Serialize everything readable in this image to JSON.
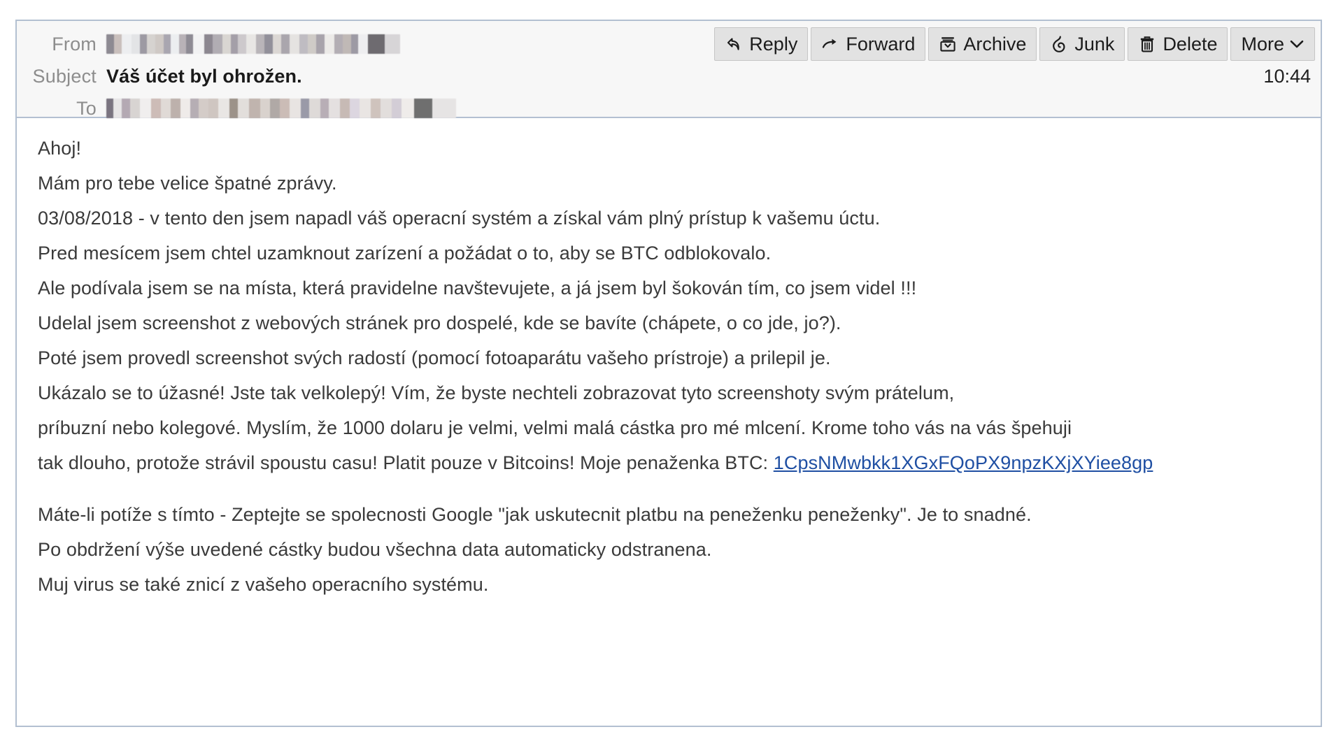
{
  "header": {
    "from_label": "From",
    "subject_label": "Subject",
    "to_label": "To",
    "from_value_redacted": true,
    "to_value_redacted": true,
    "subject": "Váš účet byl ohrožen.",
    "timestamp": "10:44"
  },
  "toolbar": {
    "buttons": [
      {
        "label": "Reply",
        "icon": "reply-arrow-icon"
      },
      {
        "label": "Forward",
        "icon": "forward-arrow-icon"
      },
      {
        "label": "Archive",
        "icon": "archive-box-icon"
      },
      {
        "label": "Junk",
        "icon": "flame-icon"
      },
      {
        "label": "Delete",
        "icon": "trash-icon"
      },
      {
        "label": "More",
        "icon": "chevron-down-icon"
      }
    ]
  },
  "body": {
    "lines": [
      "Ahoj!",
      "Mám pro tebe velice špatné zprávy.",
      "03/08/2018 - v tento den jsem napadl váš operacní systém a získal vám plný prístup k vašemu úctu.",
      "Pred mesícem jsem chtel uzamknout zarízení a požádat o to, aby se BTC odblokovalo.",
      "Ale podívala jsem se na místa, která pravidelne navštevujete, a já jsem byl šokován tím, co jsem videl !!!",
      "Udelal jsem screenshot z webových stránek pro dospelé, kde se bavíte (chápete, o co jde, jo?).",
      "Poté jsem provedl screenshot svých radostí (pomocí fotoaparátu vašeho prístroje) a prilepil je.",
      "Ukázalo se to úžasné! Jste tak velkolepý! Vím, že byste nechteli zobrazovat tyto screenshoty svým prátelum,",
      "príbuzní nebo kolegové. Myslím, že 1000 dolaru je velmi, velmi malá cástka pro mé mlcení. Krome toho vás na vás špehuji"
    ],
    "btc_line_prefix": "tak dlouho, protože strávil spoustu casu! Platit pouze v Bitcoins! Moje penaženka BTC: ",
    "btc_address": "1CpsNMwbkk1XGxFQoPX9npzKXjXYiee8gp",
    "closing_lines": [
      "Máte-li potíže s tímto - Zeptejte se spolecnosti Google \"jak uskutecnit platbu na peneženku peneženky\". Je to snadné.",
      "Po obdržení výše uvedené cástky budou všechna data automaticky odstranena.",
      "Muj virus se také znicí z vašeho operacního systému."
    ]
  },
  "colors": {
    "panel_border": "#b3c0d1",
    "header_bg": "#f7f7f7",
    "button_bg": "#e2e2e2",
    "link": "#1f4fa3",
    "body_text": "#3a3a3a",
    "label_text": "#8d8d8d"
  }
}
